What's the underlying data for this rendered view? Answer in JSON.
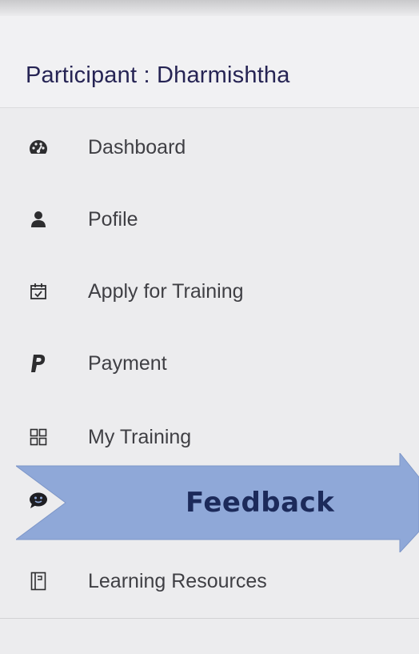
{
  "header": {
    "title": "Participant : Dharmishtha"
  },
  "menu": {
    "items": [
      {
        "label": "Dashboard",
        "icon": "dashboard-icon"
      },
      {
        "label": "Pofile",
        "icon": "user-icon"
      },
      {
        "label": "Apply for Training",
        "icon": "calendar-check-icon"
      },
      {
        "label": "Payment",
        "icon": "paypal-icon"
      },
      {
        "label": "My Training",
        "icon": "grid-icon"
      },
      {
        "label": "Feedback",
        "icon": "chat-smile-icon"
      },
      {
        "label": "Learning Resources",
        "icon": "book-icon"
      }
    ]
  },
  "annotation": {
    "label": "Feedback",
    "color": "#8fa8d8",
    "text_color": "#1c2a5a"
  }
}
